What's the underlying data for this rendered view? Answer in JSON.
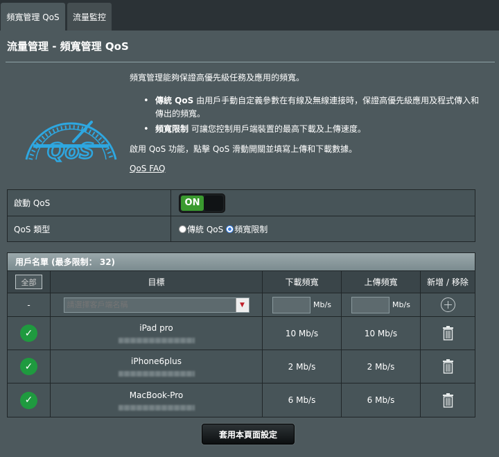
{
  "tabs": [
    {
      "label": "頻寬管理 QoS"
    },
    {
      "label": "流量監控"
    }
  ],
  "page_title": "流量管理 - 頻寬管理 QoS",
  "intro": {
    "description": "頻寬管理能夠保證高優先級任務及應用的頻寬。",
    "bullets": [
      {
        "title": "傳統 QoS",
        "text": " 由用戶手動自定義參數在有線及無線連接時，保證高優先級應用及程式傳入和傳出的頻寬。"
      },
      {
        "title": "頻寬限制",
        "text": " 可讓您控制用戶端裝置的最高下載及上傳速度。"
      }
    ],
    "enable_text": "啟用 QoS 功能，點擊 QoS 滑動開關並填寫上傳和下載數據。",
    "faq_link": "QoS FAQ",
    "logo_text": "QoS"
  },
  "settings": {
    "enable_label": "啟動 QoS",
    "enable_state": "ON",
    "type_label": "QoS 類型",
    "type_options": [
      {
        "label": "傳統 QoS",
        "checked": false
      },
      {
        "label": "頻寬限制",
        "checked": true
      }
    ]
  },
  "clients": {
    "header": "用戶名單 (最多限制： 32)",
    "columns": {
      "all": "全部",
      "target": "目標",
      "download": "下載頻寬",
      "upload": "上傳頻寬",
      "add_remove": "新增 / 移除"
    },
    "input_row": {
      "index": "-",
      "placeholder": "請選擇客戶端名稱",
      "download_value": "",
      "upload_value": "",
      "unit": "Mb/s"
    },
    "rows": [
      {
        "name": "iPad pro",
        "download": "10 Mb/s",
        "upload": "10 Mb/s"
      },
      {
        "name": "iPhone6plus",
        "download": "2 Mb/s",
        "upload": "2 Mb/s"
      },
      {
        "name": "MacBook-Pro",
        "download": "6 Mb/s",
        "upload": "6 Mb/s"
      }
    ]
  },
  "apply_button": "套用本頁面設定",
  "colors": {
    "panel": "#4d595d",
    "toggle_on": "#3a9a2f",
    "check": "#1f9a3f",
    "logo_blue": "#2ea7e0"
  }
}
